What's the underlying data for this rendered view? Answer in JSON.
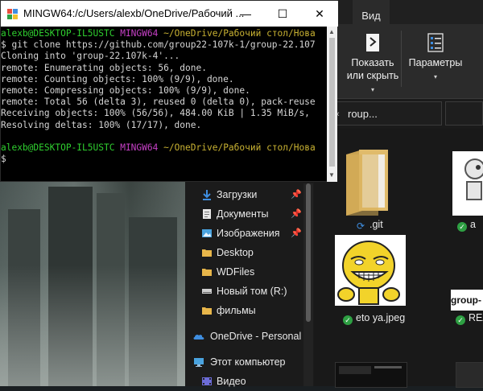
{
  "terminal": {
    "title": "MINGW64:/c/Users/alexb/OneDrive/Рабочий ...",
    "min_glyph": "—",
    "max_glyph": "☐",
    "close_glyph": "✕",
    "prompt_user": "alexb@DESKTOP-IL5USTC",
    "prompt_env": "MINGW64",
    "prompt_path": "~/OneDrive/Рабочий стол/Нова",
    "command": "$ git clone https://github.com/group22-107k-1/group-22.107",
    "output": [
      "Cloning into 'group-22.107k-4'...",
      "remote: Enumerating objects: 56, done.",
      "remote: Counting objects: 100% (9/9), done.",
      "remote: Compressing objects: 100% (9/9), done.",
      "remote: Total 56 (delta 3), reused 0 (delta 0), pack-reuse",
      "Receiving objects: 100% (56/56), 484.00 KiB | 1.35 MiB/s,",
      "Resolving deltas: 100% (17/17), done."
    ],
    "prompt2_user": "alexb@DESKTOP-IL5USTC",
    "prompt2_env": "MINGW64",
    "prompt2_path": "~/OneDrive/Рабочий стол/Нова",
    "cursor_prompt": "$"
  },
  "explorer": {
    "tab_view": "Вид",
    "ribbon": {
      "show_hide_line1": "Показать",
      "show_hide_line2": "или скрыть",
      "params_label": "Параметры",
      "caret": "▾"
    },
    "address_text": "roup...",
    "nav_items": [
      {
        "label": "Загрузки",
        "pinned": true,
        "icon": "download-icon"
      },
      {
        "label": "Документы",
        "pinned": true,
        "icon": "documents-icon"
      },
      {
        "label": "Изображения",
        "pinned": true,
        "icon": "pictures-icon"
      },
      {
        "label": "Desktop",
        "pinned": false,
        "icon": "folder-icon"
      },
      {
        "label": "WDFiles",
        "pinned": false,
        "icon": "folder-icon"
      },
      {
        "label": "Новый том (R:)",
        "pinned": false,
        "icon": "drive-icon"
      },
      {
        "label": "фильмы",
        "pinned": false,
        "icon": "folder-icon"
      },
      {
        "label": "OneDrive - Personal",
        "pinned": false,
        "icon": "onedrive-icon"
      },
      {
        "label": "Этот компьютер",
        "pinned": false,
        "icon": "computer-icon"
      },
      {
        "label": "Видео",
        "pinned": false,
        "icon": "video-icon"
      }
    ],
    "pin_glyph": "📌",
    "files": {
      "git_folder": ".git",
      "image_file": "eto ya.jpeg",
      "partial_right_top": "a",
      "readme_caption": "group-",
      "readme_name": "REA"
    }
  }
}
